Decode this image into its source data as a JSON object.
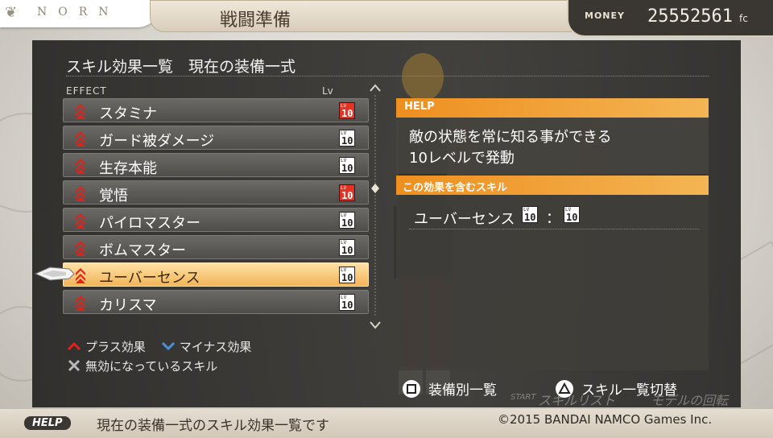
{
  "header": {
    "logo_text": "NORN",
    "logo_icon": "fleur",
    "title": "戦闘準備",
    "money_label": "MONEY",
    "money_value": "25552561",
    "money_unit": "fc"
  },
  "panel": {
    "title": "スキル効果一覧　現在の装備一式",
    "col_effect": "EFFECT",
    "col_lv": "Lv"
  },
  "skills": [
    {
      "name": "スタミナ",
      "lv_tag": "LV",
      "lv": "10",
      "badge_color": "#e43325"
    },
    {
      "name": "ガード被ダメージ",
      "lv_tag": "LV",
      "lv": "10",
      "badge_color": "#ffffff"
    },
    {
      "name": "生存本能",
      "lv_tag": "LV",
      "lv": "10",
      "badge_color": "#ffffff"
    },
    {
      "name": "覚悟",
      "lv_tag": "LV",
      "lv": "10",
      "badge_color": "#e43325"
    },
    {
      "name": "パイロマスター",
      "lv_tag": "LV",
      "lv": "10",
      "badge_color": "#ffffff"
    },
    {
      "name": "ボムマスター",
      "lv_tag": "LV",
      "lv": "10",
      "badge_color": "#ffffff"
    },
    {
      "name": "ユーバーセンス",
      "lv_tag": "LV",
      "lv": "10",
      "badge_color": "#ffffff",
      "selected": true
    },
    {
      "name": "カリスマ",
      "lv_tag": "LV",
      "lv": "10",
      "badge_color": "#ffffff"
    }
  ],
  "legend": {
    "plus": "プラス効果",
    "minus": "マイナス効果",
    "disabled": "無効になっているスキル",
    "plus_color": "#e0231a",
    "minus_color": "#4d8fd9"
  },
  "help": {
    "label": "HELP",
    "line1": "敵の状態を常に知る事ができる",
    "line2": "10レベルで発動"
  },
  "included": {
    "label": "この効果を含むスキル",
    "skill_name": "ユーバーセンス",
    "lv_tag": "LV",
    "lv1": "10",
    "separator": "：",
    "lv2": "10"
  },
  "buttons": {
    "square_label": "装備別一覧",
    "triangle_label": "スキル一覧切替",
    "ghost_start": "START",
    "ghost_skill_list": "スキルリスト",
    "ghost_rotate": "モデルの回転"
  },
  "footer": {
    "help_tag": "HELP",
    "message": "現在の装備一式のスキル効果一覧です",
    "copyright": "©2015 BANDAI NAMCO Games Inc."
  }
}
